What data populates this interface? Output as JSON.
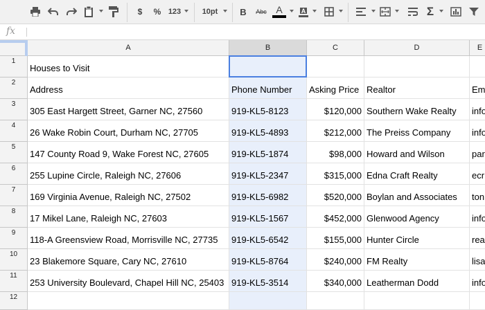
{
  "toolbar": {
    "currency_label": "$",
    "percent_label": "%",
    "number_format_label": "123",
    "font_size_label": "10pt",
    "bold_label": "B",
    "strike_label": "Abc",
    "text_color_label": "A",
    "text_color_value": "#000000"
  },
  "formula_bar": {
    "fx_label": "fx",
    "value": ""
  },
  "columns": [
    {
      "label": "A",
      "selected": false
    },
    {
      "label": "B",
      "selected": true
    },
    {
      "label": "C",
      "selected": false
    },
    {
      "label": "D",
      "selected": false
    },
    {
      "label": "E",
      "selected": false
    }
  ],
  "rows": [
    {
      "num": "1",
      "cells": [
        "Houses to Visit",
        "",
        "",
        "",
        ""
      ]
    },
    {
      "num": "2",
      "cells": [
        "Address",
        "Phone Number",
        "Asking Price",
        "Realtor",
        "Em"
      ]
    },
    {
      "num": "3",
      "cells": [
        "305 East Hargett Street, Garner NC, 27560",
        "919-KL5-8123",
        "$120,000",
        "Southern Wake Realty",
        "info"
      ]
    },
    {
      "num": "4",
      "cells": [
        "26 Wake Robin Court, Durham NC, 27705",
        "919-KL5-4893",
        "$212,000",
        "The Preiss Company",
        "info"
      ]
    },
    {
      "num": "5",
      "cells": [
        "147 County Road 9, Wake Forest NC, 27605",
        "919-KL5-1874",
        "$98,000",
        "Howard and Wilson",
        "par"
      ]
    },
    {
      "num": "6",
      "cells": [
        "255 Lupine Circle, Raleigh NC, 27606",
        "919-KL5-2347",
        "$315,000",
        "Edna Craft Realty",
        "ecr"
      ]
    },
    {
      "num": "7",
      "cells": [
        "169 Virginia Avenue, Raleigh NC, 27502",
        "919-KL5-6982",
        "$520,000",
        "Boylan and Associates",
        "ton"
      ]
    },
    {
      "num": "8",
      "cells": [
        "17 Mikel Lane, Raleigh NC, 27603",
        "919-KL5-1567",
        "$452,000",
        "Glenwood Agency",
        "info"
      ]
    },
    {
      "num": "9",
      "cells": [
        "118-A Greensview Road, Morrisville NC, 27735",
        "919-KL5-6542",
        "$155,000",
        "Hunter Circle",
        "rea"
      ]
    },
    {
      "num": "10",
      "cells": [
        "23 Blakemore Square, Cary NC, 27610",
        "919-KL5-8764",
        "$240,000",
        "FM Realty",
        "lisa"
      ]
    },
    {
      "num": "11",
      "cells": [
        "253 University Boulevard, Chapel Hill NC, 25403",
        "919-KL5-3514",
        "$340,000",
        "Leatherman Dodd",
        "info"
      ]
    },
    {
      "num": "12",
      "cells": [
        "",
        "",
        "",
        "",
        ""
      ]
    }
  ],
  "colors": {
    "selection_border": "#4a7fe0",
    "selected_column_fill": "#e8effb",
    "header_fill": "#f3f3f3"
  }
}
